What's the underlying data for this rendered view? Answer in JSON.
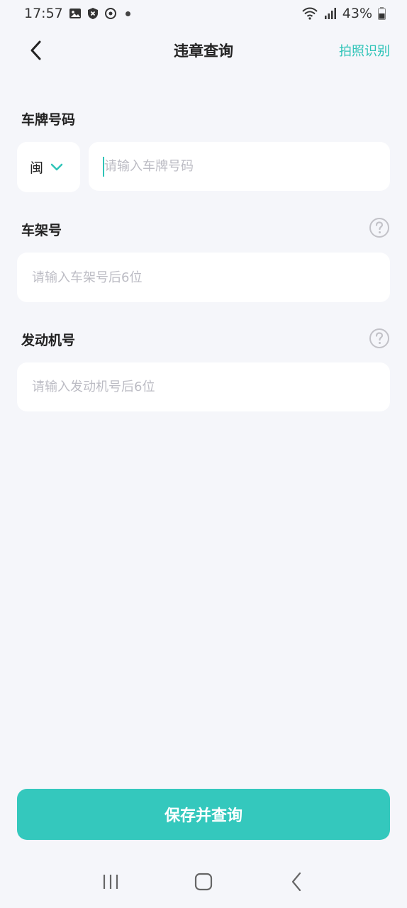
{
  "status_bar": {
    "time": "17:57",
    "battery": "43%",
    "icons_left": [
      "image-icon",
      "shield-x-icon",
      "sync-icon",
      "dot-icon"
    ],
    "icons_right": [
      "wifi-icon",
      "signal-icon",
      "battery-icon"
    ]
  },
  "header": {
    "title": "违章查询",
    "action": "拍照识别",
    "accent_color": "#2fc4b8"
  },
  "plate": {
    "label": "车牌号码",
    "province": "闽",
    "placeholder": "请输入车牌号码"
  },
  "vin": {
    "label": "车架号",
    "placeholder": "请输入车架号后6位"
  },
  "engine": {
    "label": "发动机号",
    "placeholder": "请输入发动机号后6位"
  },
  "submit": {
    "label": "保存并查询",
    "color": "#34c8bd"
  },
  "system_nav": {
    "buttons": [
      "recent-apps-icon",
      "home-icon",
      "back-icon"
    ]
  }
}
